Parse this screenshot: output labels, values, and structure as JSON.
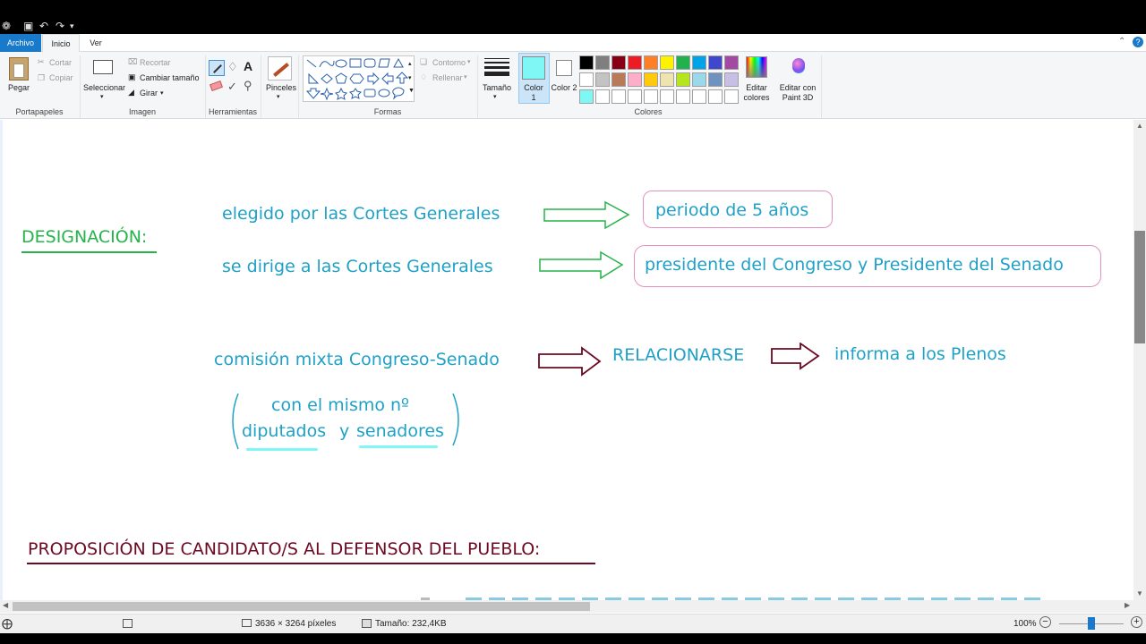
{
  "tabs": {
    "file": "Archivo",
    "home": "Inicio",
    "view": "Ver"
  },
  "clipboard": {
    "paste": "Pegar",
    "cut": "Cortar",
    "copy": "Copiar",
    "group": "Portapapeles"
  },
  "image": {
    "select": "Seleccionar",
    "crop": "Recortar",
    "resize": "Cambiar tamaño",
    "rotate": "Girar",
    "group": "Imagen"
  },
  "tools": {
    "group": "Herramientas"
  },
  "brushes": {
    "label": "Pinceles"
  },
  "shapes": {
    "outline": "Contorno",
    "fill": "Rellenar",
    "group": "Formas"
  },
  "size": {
    "label": "Tamaño"
  },
  "colors": {
    "color1": "Color 1",
    "color2": "Color 2",
    "edit": "Editar colores",
    "paint3d": "Editar con Paint 3D",
    "group": "Colores",
    "color1_value": "#7ff7f5",
    "color2_value": "#ffffff",
    "palette_row1": [
      "#000000",
      "#7f7f7f",
      "#880015",
      "#ed1c24",
      "#ff7f27",
      "#fff200",
      "#22b14c",
      "#00a2e8",
      "#3f48cc",
      "#a349a4"
    ],
    "palette_row2": [
      "#ffffff",
      "#c3c3c3",
      "#b97a57",
      "#ffaec9",
      "#ffc90e",
      "#efe4b0",
      "#b5e61d",
      "#99d9ea",
      "#7092be",
      "#c8bfe7"
    ],
    "palette_row3": [
      "#7ff7f5",
      "#ffffff",
      "#ffffff",
      "#ffffff",
      "#ffffff",
      "#ffffff",
      "#ffffff",
      "#ffffff",
      "#ffffff",
      "#ffffff"
    ]
  },
  "canvas": {
    "designacion": "DESIGNACIÓN:",
    "line1": "elegido por las Cortes Generales",
    "box1": "periodo de 5 años",
    "line2": "se dirige a las Cortes Generales",
    "box2": "presidente del Congreso y Presidente del Senado",
    "comision": "comisión mixta Congreso-Senado",
    "relacionarse": "RELACIONARSE",
    "informa": "informa a los Plenos",
    "mismo": "con el mismo nº",
    "diputados": "diputados",
    "y": "y",
    "senadores": "senadores",
    "proposicion": "PROPOSICIÓN DE CANDIDATO/S AL DEFENSOR DEL PUEBLO:"
  },
  "status": {
    "dimensions": "3636 × 3264 píxeles",
    "filesize": "Tamaño: 232,4KB",
    "zoom": "100%"
  }
}
